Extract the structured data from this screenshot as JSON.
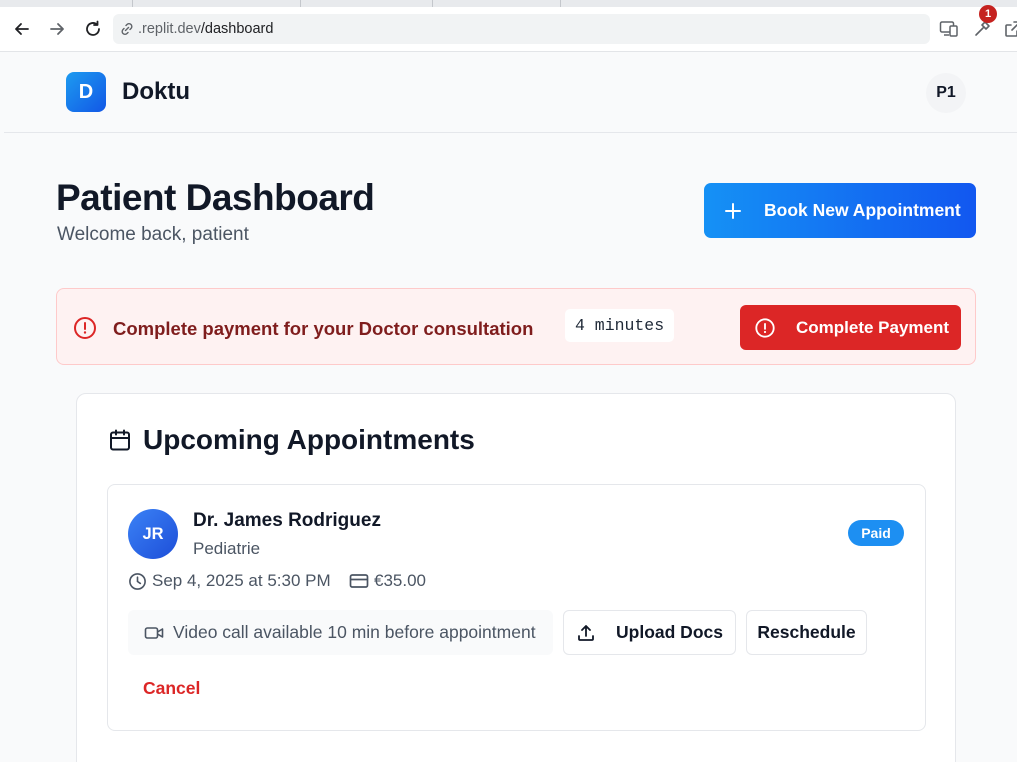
{
  "browser": {
    "url_host": ".replit.dev",
    "url_path": "/dashboard",
    "extensions_badge": "1"
  },
  "header": {
    "logo_letter": "D",
    "brand": "Doktu",
    "user_initials": "P1"
  },
  "page": {
    "title": "Patient Dashboard",
    "subtitle": "Welcome back, patient",
    "book_button": "Book New Appointment"
  },
  "alert": {
    "message": "Complete payment for your Doctor consultation",
    "timer": "4 minutes",
    "button": "Complete Payment"
  },
  "appointments": {
    "title": "Upcoming Appointments",
    "items": [
      {
        "initials": "JR",
        "doctor": "Dr. James Rodriguez",
        "specialty": "Pediatrie",
        "status": "Paid",
        "datetime": "Sep 4, 2025 at 5:30 PM",
        "price": "€35.00",
        "video_note": "Video call available 10 min before appointment",
        "upload_label": "Upload Docs",
        "reschedule_label": "Reschedule",
        "cancel_label": "Cancel"
      }
    ]
  },
  "colors": {
    "primary": "#1d8ff2",
    "danger": "#dc2626",
    "alert_bg": "#fef2f2"
  },
  "icons": [
    "back-icon",
    "forward-icon",
    "reload-icon",
    "link-icon",
    "cast-icon",
    "extensions-icon",
    "share-icon",
    "plus-icon",
    "alert-circle-icon",
    "calendar-icon",
    "clock-icon",
    "credit-card-icon",
    "video-icon",
    "upload-icon"
  ]
}
